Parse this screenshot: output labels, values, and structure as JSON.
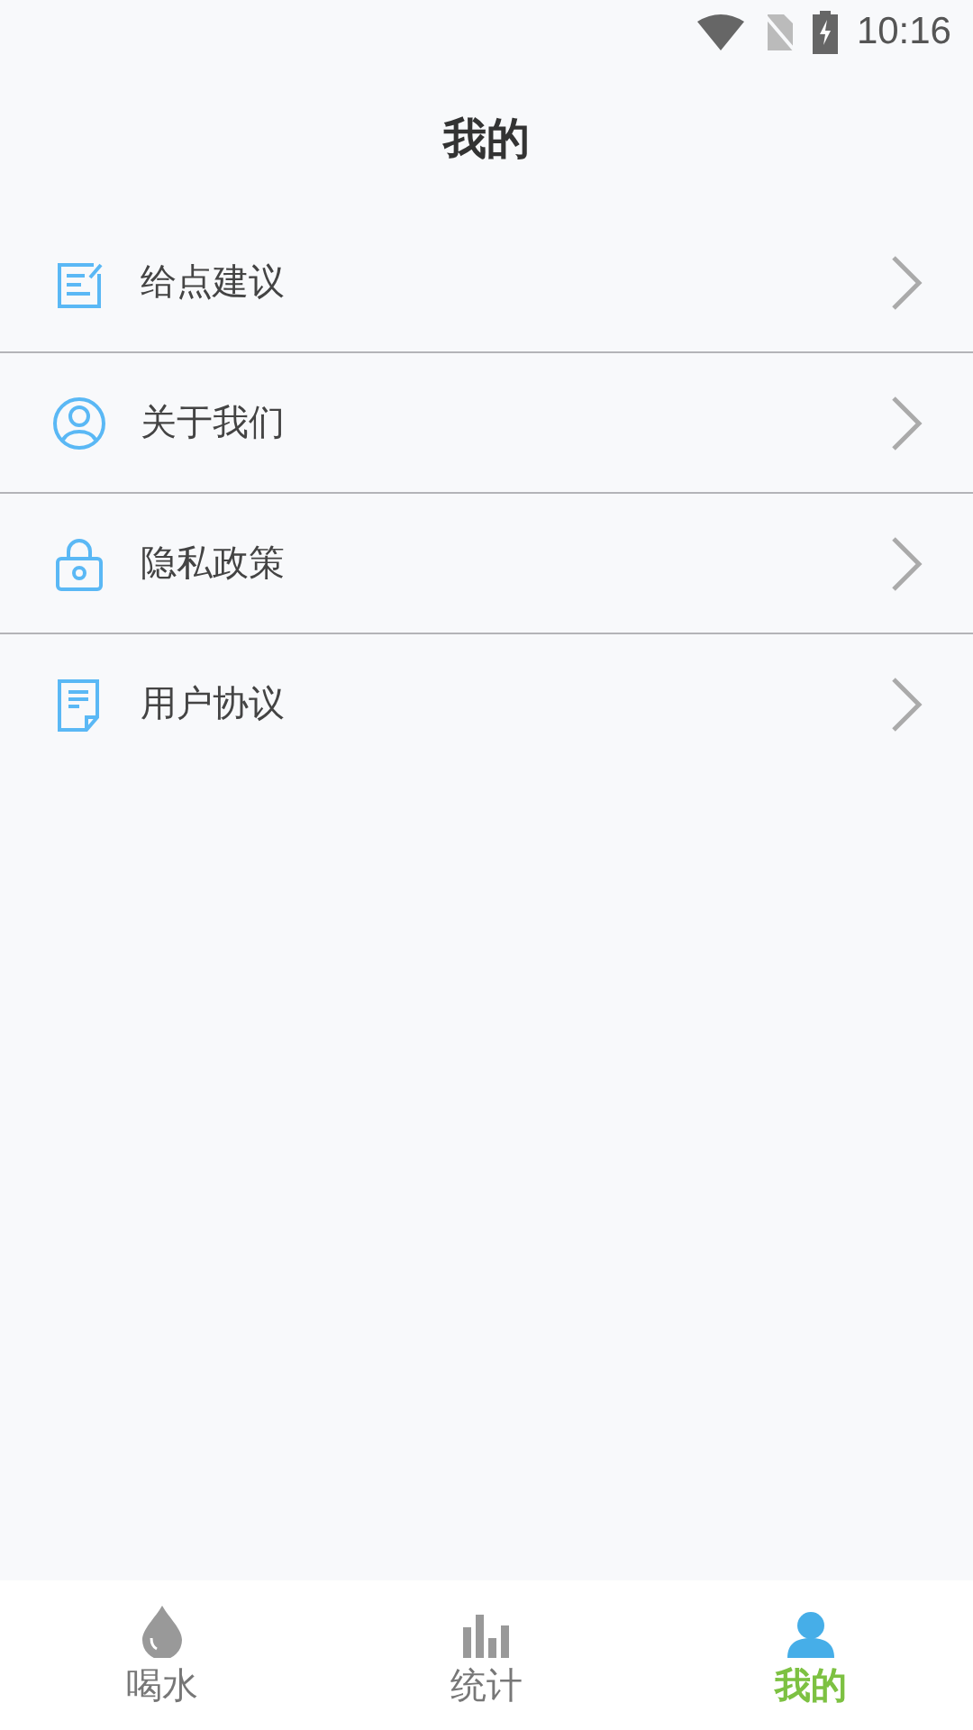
{
  "status_bar": {
    "time": "10:16"
  },
  "title": "我的",
  "menu": [
    {
      "label": "给点建议"
    },
    {
      "label": "关于我们"
    },
    {
      "label": "隐私政策"
    },
    {
      "label": "用户协议"
    }
  ],
  "tabs": [
    {
      "label": "喝水",
      "selected": false
    },
    {
      "label": "统计",
      "selected": false
    },
    {
      "label": "我的",
      "selected": true
    }
  ]
}
